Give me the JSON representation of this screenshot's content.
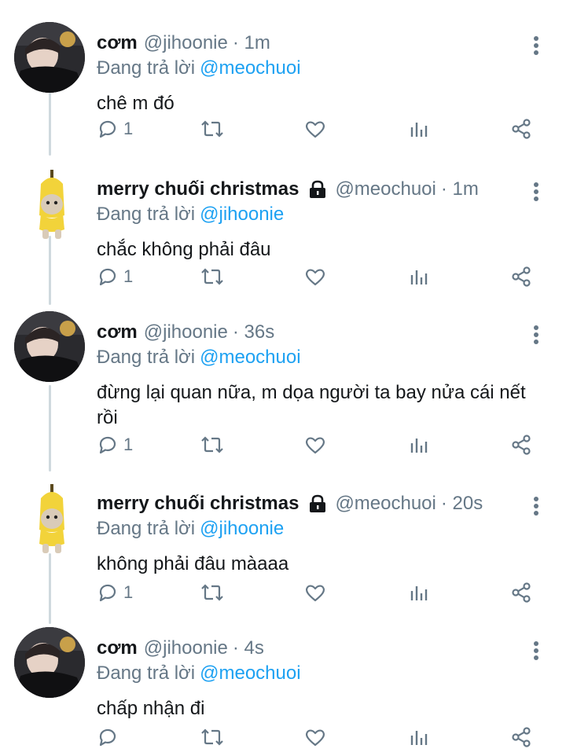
{
  "tweets": [
    {
      "name": "cơm",
      "handle": "@jihoonie",
      "time": "· 1m",
      "locked": false,
      "replying_prefix": "Đang trả lời",
      "replying_to": "@meochuoi",
      "text": "chê m đó",
      "reply_count": "1",
      "avatar": "photo-avatar"
    },
    {
      "name": "merry chuối christmas",
      "handle": "@meochuoi",
      "time": "· 1m",
      "locked": true,
      "replying_prefix": "Đang trả lời",
      "replying_to": "@jihoonie",
      "text": "chắc không phải đâu",
      "reply_count": "1",
      "avatar": "banana-cat-avatar"
    },
    {
      "name": "cơm",
      "handle": "@jihoonie",
      "time": "· 36s",
      "locked": false,
      "replying_prefix": "Đang trả lời",
      "replying_to": "@meochuoi",
      "text": "đừng lại quan nữa, m dọa người ta bay nửa cái nết rồi",
      "reply_count": "1",
      "avatar": "photo-avatar"
    },
    {
      "name": "merry chuối christmas",
      "handle": "@meochuoi",
      "time": "· 20s",
      "locked": true,
      "replying_prefix": "Đang trả lời",
      "replying_to": "@jihoonie",
      "text": "không phải đâu màaaa",
      "reply_count": "1",
      "avatar": "banana-cat-avatar"
    },
    {
      "name": "cơm",
      "handle": "@jihoonie",
      "time": "· 4s",
      "locked": false,
      "replying_prefix": "Đang trả lời",
      "replying_to": "@meochuoi",
      "text": "chấp nhận đi",
      "reply_count": "",
      "avatar": "photo-avatar"
    }
  ],
  "colors": {
    "mention": "#1da1f2",
    "meta": "#657786",
    "thread_line": "#cfd9de"
  }
}
